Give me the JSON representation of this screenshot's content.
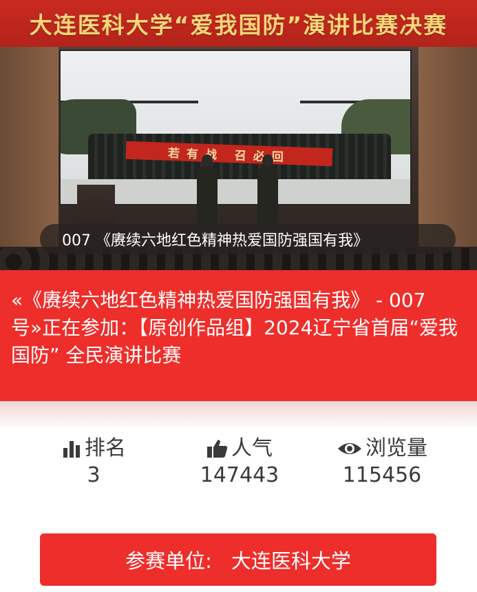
{
  "hero": {
    "banner_text": "大连医科大学“爱我国防”演讲比赛决赛",
    "screen_slogan": "若有战 召必回",
    "caption": "007 《赓续六地红色精神热爱国防强国有我》"
  },
  "entry": {
    "title": "«《赓续六地红色精神热爱国防强国有我》 - 007号»正在参加：【原创作品组】2024辽宁省首届“爱我国防” 全民演讲比赛"
  },
  "stats": {
    "rank": {
      "icon": "bar-chart-icon",
      "label": "排名",
      "value": "3"
    },
    "popularity": {
      "icon": "thumbs-up-icon",
      "label": "人气",
      "value": "147443"
    },
    "views": {
      "icon": "eye-icon",
      "label": "浏览量",
      "value": "115456"
    }
  },
  "unit": {
    "label": "参赛单位:",
    "value": "大连医科大学"
  },
  "colors": {
    "accent_red": "#ee2e2b",
    "banner_red": "#c92a1f",
    "banner_text": "#f6d77a",
    "stat_text": "#3a3a3a"
  }
}
